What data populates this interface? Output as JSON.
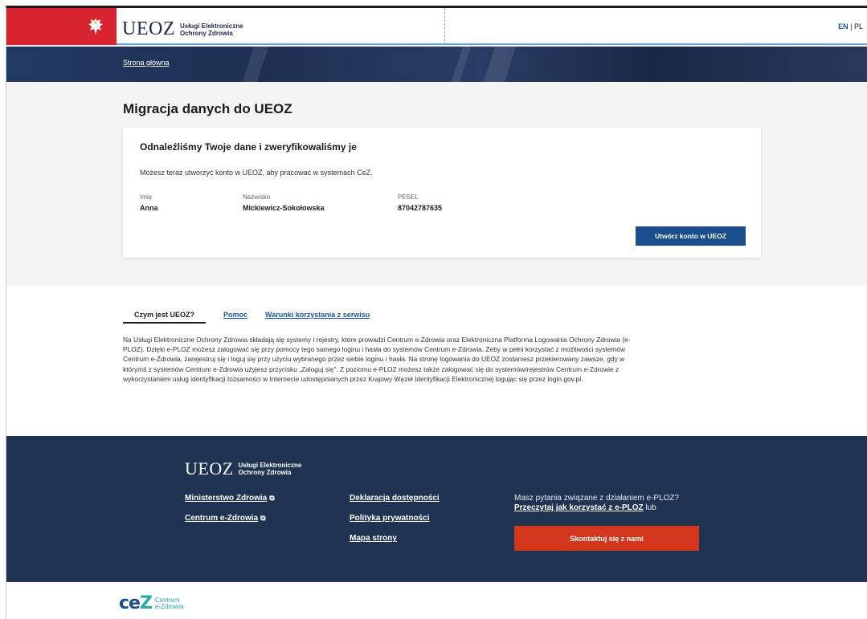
{
  "header": {
    "logo_abbr": "UEOZ",
    "logo_line1": "Usługi Elektroniczne",
    "logo_line2": "Ochrony Zdrowia",
    "lang_en": "EN",
    "lang_sep": "|",
    "lang_pl": "PL"
  },
  "breadcrumb": {
    "home": "Strona główna"
  },
  "main": {
    "page_title": "Migracja danych do UEOZ",
    "card_title": "Odnaleźliśmy Twoje dane i zweryfikowaliśmy je",
    "card_desc": "Możesz teraz utworzyć konto w UEOZ, aby pracować w systemach CeZ.",
    "fields": [
      {
        "label": "Imię",
        "value": "Anna"
      },
      {
        "label": "Nazwisko",
        "value": "Mickiewicz-Sokołowska"
      },
      {
        "label": "PESEL",
        "value": "87042787635"
      }
    ],
    "create_button": "Utwórz konto w UEOZ"
  },
  "info": {
    "tabs": [
      {
        "label": "Czym jest UEOZ?",
        "active": true
      },
      {
        "label": "Pomoc",
        "active": false
      },
      {
        "label": "Warunki korzystania z serwisu",
        "active": false
      }
    ],
    "text": "Na Usługi Elektroniczne Ochrony Zdrowia składają się systemy i rejestry, które prowadzi Centrum e-Zdrowia oraz Elektroniczna Platforma Logowania Ochrony Zdrowia (e-PLOZ). Dzięki e-PLOZ możesz zalogować się przy pomocy tego samego loginu i hasła do systemów Centrum e-Zdrowia. Żeby w pełni korzystać z możliwości systemów Centrum e-Zdrowia, zarejestruj się i loguj się przy użyciu wybranego przez siebie loginu i hasła. Na stronę logowania do UEOZ zostaniesz przekierowany zawsze, gdy w którymś z systemów Centrum e-Zdrowia użyjesz przycisku „Zaloguj się”. Z poziomu e-PLOZ możesz także zalogować się do systemów/rejestrów Centrum e-Zdrowie z wykorzystaniem usług identyfikacji tożsamości w Internecie udostępnianych przez Krajowy Węzeł Identyfikacji Elektronicznej logując się przez login.gov.pl."
  },
  "footer": {
    "links_col1": [
      "Ministerstwo Zdrowia",
      "Centrum e-Zdrowia"
    ],
    "links_col2": [
      "Deklaracja dostępności",
      "Polityka prywatności",
      "Mapa strony"
    ],
    "question": "Masz pytania związane z działaniem e-PLOZ?",
    "howto_link": "Przeczytaj jak korzystać z e-PLOZ",
    "howto_suffix": " lub",
    "contact_button": "Skontaktuj się z nami"
  },
  "bottom": {
    "cez_mark_c": "ce",
    "cez_mark_z": "Z",
    "cez_line1": "Centrum",
    "cez_line2": "e-Zdrowia"
  },
  "colors": {
    "accent_red": "#d7222f",
    "primary_blue": "#1a4e8c",
    "footer_navy": "#1f3352",
    "contact_orange": "#d3381e"
  }
}
